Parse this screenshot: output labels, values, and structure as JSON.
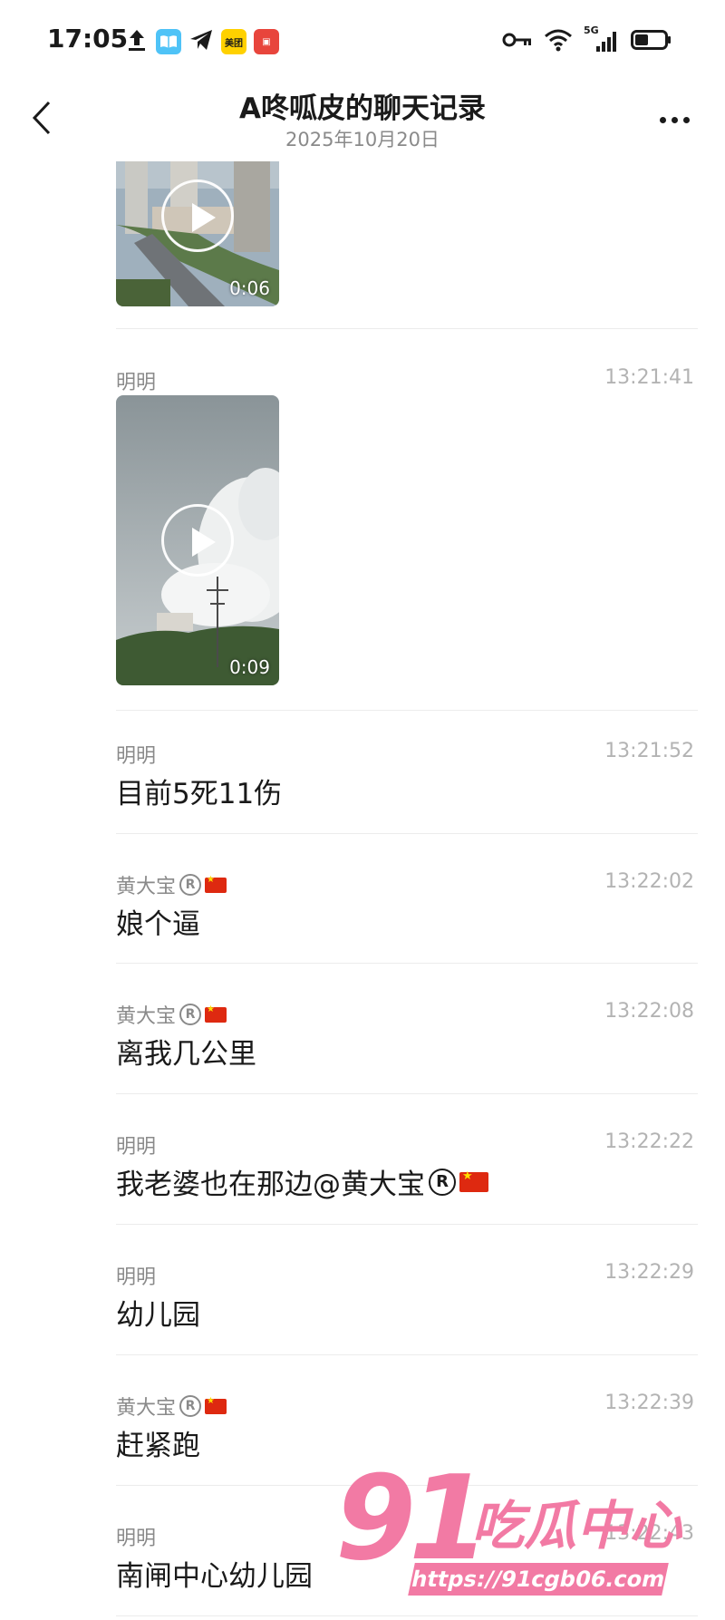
{
  "status_bar": {
    "time": "17:05",
    "network": "5G",
    "app_icons": [
      "upload-icon",
      "book-icon",
      "telegram-icon",
      "meituan-icon",
      "app-icon"
    ]
  },
  "header": {
    "title": "A咚呱皮的聊天记录",
    "date": "2025年10月20日"
  },
  "videos": [
    {
      "duration": "0:06"
    },
    {
      "duration": "0:09"
    }
  ],
  "messages": [
    {
      "sender": "明明",
      "time": "13:21:41",
      "text": ""
    },
    {
      "sender": "明明",
      "time": "13:21:52",
      "text": "目前5死11伤"
    },
    {
      "sender": "黄大宝",
      "time": "13:22:02",
      "text": "娘个逼"
    },
    {
      "sender": "黄大宝",
      "time": "13:22:08",
      "text": "离我几公里"
    },
    {
      "sender": "明明",
      "time": "13:22:22",
      "text": "我老婆也在那边@黄大宝"
    },
    {
      "sender": "明明",
      "time": "13:22:29",
      "text": "幼儿园"
    },
    {
      "sender": "黄大宝",
      "time": "13:22:39",
      "text": "赶紧跑"
    },
    {
      "sender": "明明",
      "time": "13:22:43",
      "text": "南闸中心幼儿园"
    }
  ],
  "watermark": {
    "number": "91",
    "name": "吃瓜中心",
    "url": "https://91cgb06.com"
  },
  "colors": {
    "watermark_pink": "#f27aa4",
    "timestamp_gray": "#b3b3b3",
    "sender_gray": "#8a8a8a"
  }
}
